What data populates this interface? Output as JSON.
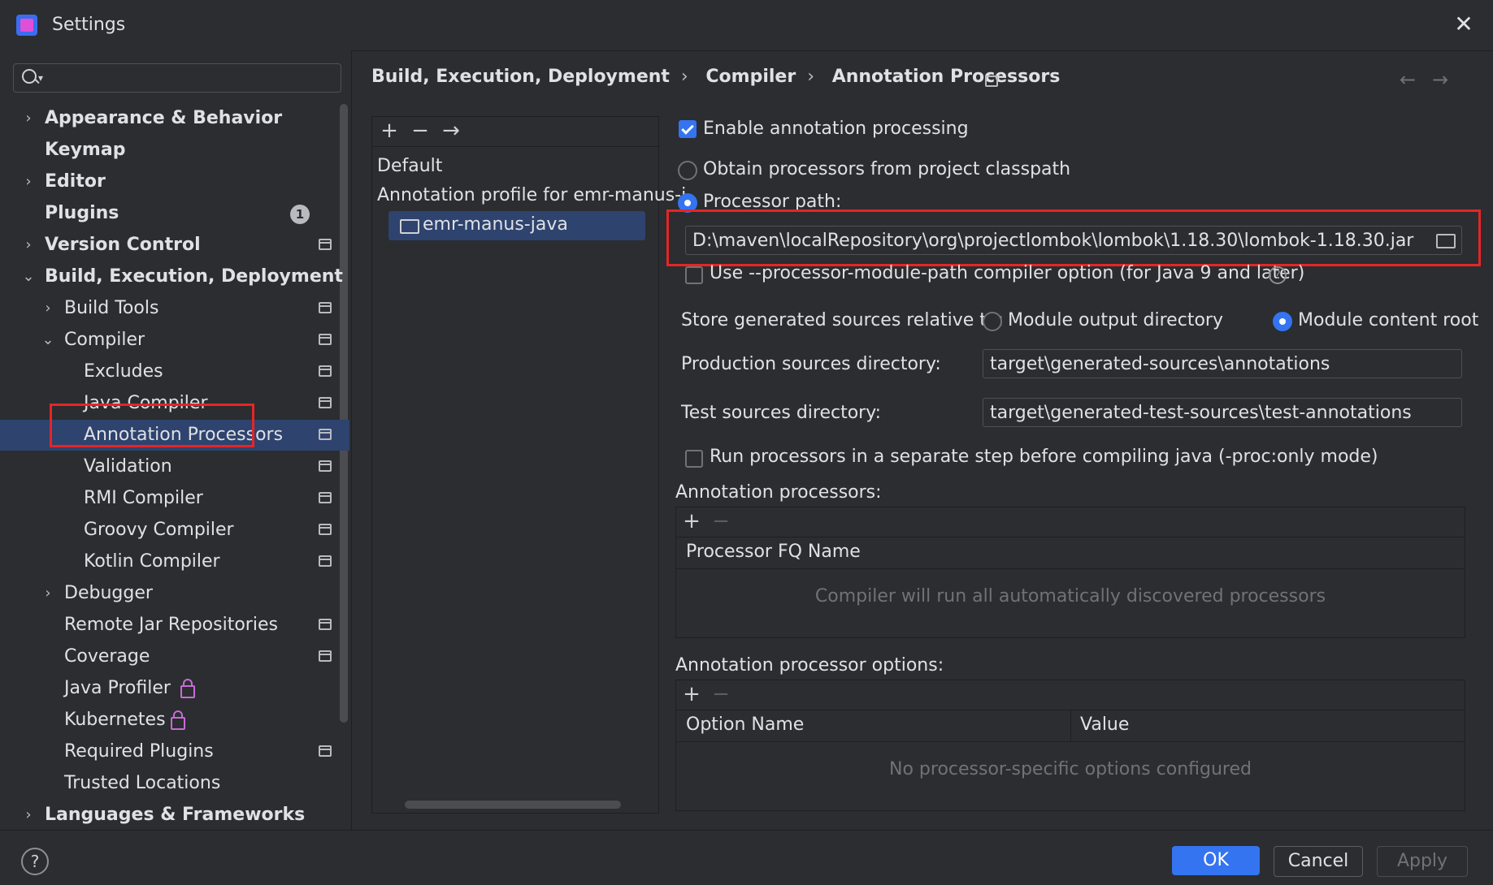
{
  "window": {
    "title": "Settings"
  },
  "search": {
    "placeholder": ""
  },
  "sidebar": {
    "items": [
      {
        "label": "Appearance & Behavior",
        "bold": true
      },
      {
        "label": "Keymap",
        "bold": true
      },
      {
        "label": "Editor",
        "bold": true
      },
      {
        "label": "Plugins",
        "bold": true,
        "badge": "1"
      },
      {
        "label": "Version Control",
        "bold": true
      },
      {
        "label": "Build, Execution, Deployment",
        "bold": true
      },
      {
        "label": "Build Tools"
      },
      {
        "label": "Compiler"
      },
      {
        "label": "Excludes"
      },
      {
        "label": "Java Compiler"
      },
      {
        "label": "Annotation Processors"
      },
      {
        "label": "Validation"
      },
      {
        "label": "RMI Compiler"
      },
      {
        "label": "Groovy Compiler"
      },
      {
        "label": "Kotlin Compiler"
      },
      {
        "label": "Debugger"
      },
      {
        "label": "Remote Jar Repositories"
      },
      {
        "label": "Coverage"
      },
      {
        "label": "Java Profiler"
      },
      {
        "label": "Kubernetes"
      },
      {
        "label": "Required Plugins"
      },
      {
        "label": "Trusted Locations"
      },
      {
        "label": "Languages & Frameworks",
        "bold": true
      }
    ]
  },
  "breadcrumb": [
    "Build, Execution, Deployment",
    "Compiler",
    "Annotation Processors"
  ],
  "profiles": {
    "items": [
      "Default",
      "Annotation profile for emr-manus-j",
      "emr-manus-java"
    ]
  },
  "settings": {
    "enable_label": "Enable annotation processing",
    "enable_checked": true,
    "classpath_label": "Obtain processors from project classpath",
    "processor_path_label": "Processor path:",
    "processor_path_value": "D:\\maven\\localRepository\\org\\projectlombok\\lombok\\1.18.30\\lombok-1.18.30.jar",
    "module_path_label": "Use --processor-module-path compiler option (for Java 9 and later)",
    "store_label": "Store generated sources relative to:",
    "module_output_label": "Module output directory",
    "module_content_label": "Module content root",
    "production_label": "Production sources directory:",
    "production_value": "target\\generated-sources\\annotations",
    "test_label": "Test sources directory:",
    "test_value": "target\\generated-test-sources\\test-annotations",
    "run_separate_label": "Run processors in a separate step before compiling java (-proc:only mode)",
    "processors_section": "Annotation processors:",
    "processors_header": "Processor FQ Name",
    "processors_empty": "Compiler will run all automatically discovered processors",
    "options_section": "Annotation processor options:",
    "options_header_name": "Option Name",
    "options_header_value": "Value",
    "options_empty": "No processor-specific options configured"
  },
  "footer": {
    "ok": "OK",
    "cancel": "Cancel",
    "apply": "Apply",
    "help": "?"
  },
  "colors": {
    "accent": "#3574f0",
    "selection": "#2e436e",
    "highlight_box": "#e62525"
  }
}
